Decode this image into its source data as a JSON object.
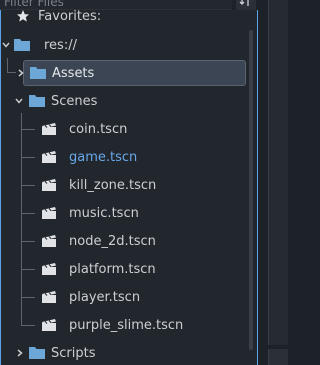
{
  "filter": {
    "placeholder": "Filter Files"
  },
  "favorites": {
    "label": "Favorites:"
  },
  "tree": {
    "root": {
      "label": "res://"
    },
    "assets": {
      "label": "Assets"
    },
    "scenes": {
      "label": "Scenes"
    },
    "files": [
      {
        "label": "coin.tscn"
      },
      {
        "label": "game.tscn"
      },
      {
        "label": "kill_zone.tscn"
      },
      {
        "label": "music.tscn"
      },
      {
        "label": "node_2d.tscn"
      },
      {
        "label": "platform.tscn"
      },
      {
        "label": "player.tscn"
      },
      {
        "label": "purple_slime.tscn"
      }
    ],
    "scripts": {
      "label": "Scripts"
    }
  },
  "colors": {
    "folder": "#6ca7d8",
    "active_text": "#67a9ea",
    "focus_border": "#5aa2ea"
  }
}
